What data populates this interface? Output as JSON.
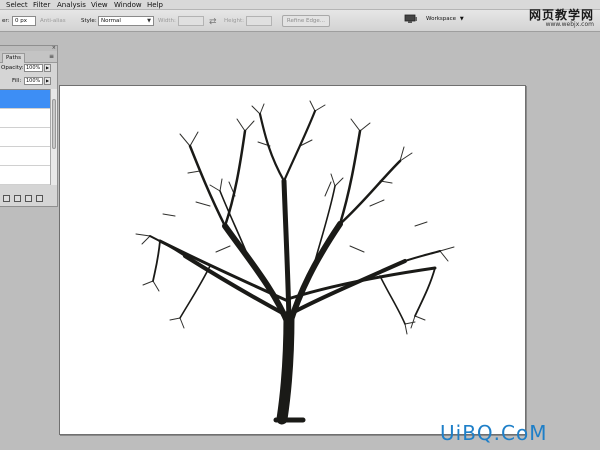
{
  "menu": {
    "items": [
      "Select",
      "Filter",
      "Analysis",
      "View",
      "Window",
      "Help"
    ]
  },
  "options": {
    "feather_label": "er:",
    "feather_value": "0 px",
    "antialias_label": "Anti-alias",
    "style_label": "Style:",
    "style_value": "Normal",
    "width_label": "Width:",
    "height_label": "Height:",
    "refine_label": "Refine Edge...",
    "workspace_label": "Workspace"
  },
  "watermark_top": {
    "line1": "网页教学网",
    "line2": "www.webjx.com"
  },
  "panel": {
    "tab_label": "Paths",
    "opacity_label": "Opacity:",
    "opacity_value": "100%",
    "fill_label": "Fill:",
    "fill_value": "100%"
  },
  "watermark_bottom": "UiBQ.CoM",
  "colors": {
    "selected_layer": "#3d8ef5",
    "watermark_blue": "#1e7fc8",
    "tree": "#1a1a17"
  }
}
